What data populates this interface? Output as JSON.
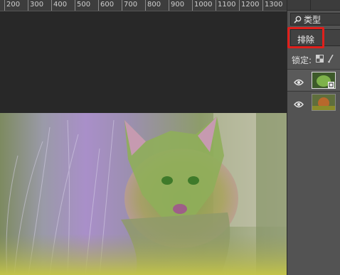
{
  "ruler": {
    "labels": [
      "200",
      "300",
      "400",
      "500",
      "600",
      "700",
      "800",
      "900",
      "1000",
      "1100",
      "1200",
      "1300"
    ]
  },
  "layers_panel": {
    "filter_kind_label": "类型",
    "blend_mode_value": "排除",
    "lock_label": "锁定:",
    "layers": [
      {
        "name": "smart-object-layer",
        "visible": true,
        "selected": true
      },
      {
        "name": "background-photo-layer",
        "visible": true,
        "selected": false
      }
    ]
  },
  "colors": {
    "highlight": "#e0201c",
    "panel_bg": "#535353",
    "canvas_bg": "#282828"
  }
}
